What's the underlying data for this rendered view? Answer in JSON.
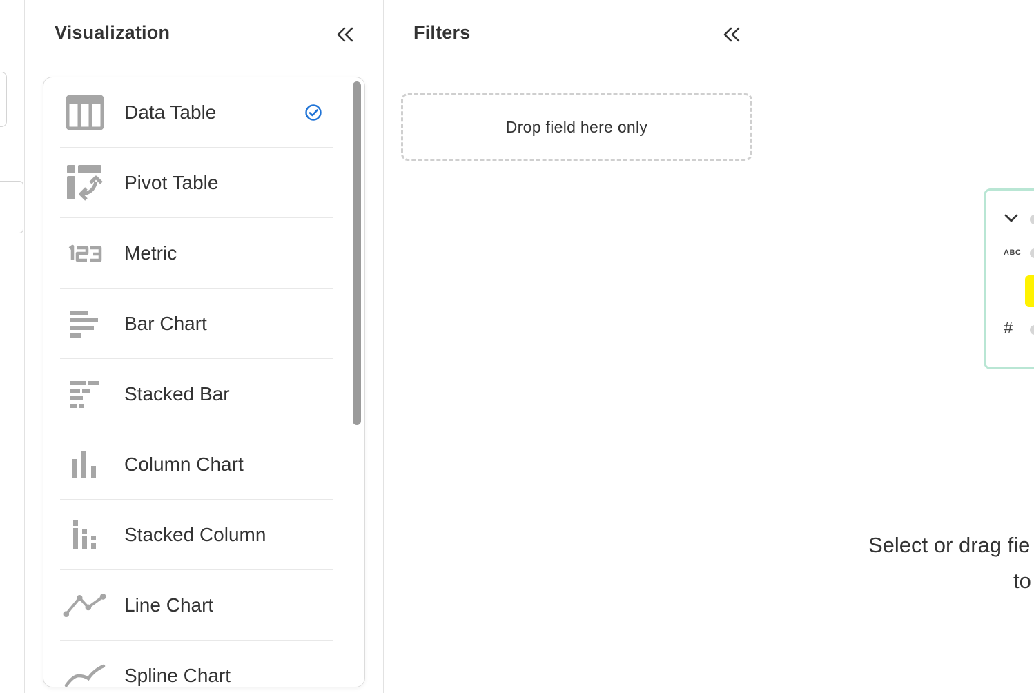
{
  "visualization_panel": {
    "title": "Visualization",
    "selected_index": 0,
    "items": [
      {
        "label": "Data Table",
        "icon": "data-table-icon",
        "selected": true
      },
      {
        "label": "Pivot Table",
        "icon": "pivot-table-icon",
        "selected": false
      },
      {
        "label": "Metric",
        "icon": "metric-123-icon",
        "selected": false
      },
      {
        "label": "Bar Chart",
        "icon": "bar-chart-icon",
        "selected": false
      },
      {
        "label": "Stacked Bar",
        "icon": "stacked-bar-icon",
        "selected": false
      },
      {
        "label": "Column Chart",
        "icon": "column-chart-icon",
        "selected": false
      },
      {
        "label": "Stacked Column",
        "icon": "stacked-column-icon",
        "selected": false
      },
      {
        "label": "Line Chart",
        "icon": "line-chart-icon",
        "selected": false
      },
      {
        "label": "Spline Chart",
        "icon": "spline-chart-icon",
        "selected": false
      }
    ]
  },
  "filters_panel": {
    "title": "Filters",
    "drop_zone_text": "Drop field here only"
  },
  "main_area": {
    "preview_card": {
      "abc_label": "ABC",
      "hash_label": "#"
    },
    "empty_message_line1": "Select or drag fie",
    "empty_message_line2": "to"
  },
  "colors": {
    "icon_gray": "#a6a6a6",
    "check_blue": "#1f73d6",
    "preview_border": "#b9e6d4",
    "highlight_yellow": "#fff200",
    "divider": "#e2e2e2"
  }
}
